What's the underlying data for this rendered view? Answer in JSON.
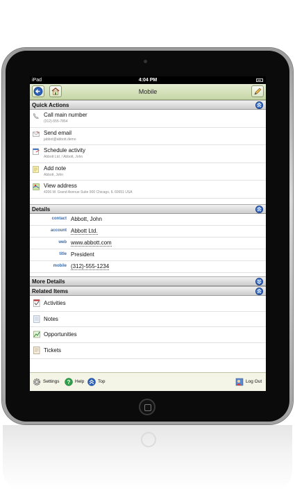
{
  "status_bar": {
    "carrier": "iPad",
    "time": "4:04 PM"
  },
  "toolbar": {
    "title": "Mobile"
  },
  "quick_actions": {
    "title": "Quick Actions",
    "items": [
      {
        "label": "Call main number",
        "sub": "(312)-555-7854",
        "icon": "phone-icon"
      },
      {
        "label": "Send email",
        "sub": "jabbot@abbott.demo",
        "icon": "email-icon"
      },
      {
        "label": "Schedule activity",
        "sub": "Abbott Ltd. / Abbott, John",
        "icon": "calendar-icon"
      },
      {
        "label": "Add note",
        "sub": "Abbott, John",
        "icon": "note-icon"
      },
      {
        "label": "View address",
        "sub": "4206 W. Grand Avenue Suite 900 Chicago, IL 60651 USA",
        "icon": "map-icon"
      }
    ]
  },
  "details": {
    "title": "Details",
    "rows": [
      {
        "label": "contact",
        "value": "Abbott, John"
      },
      {
        "label": "account",
        "value": "Abbott Ltd."
      },
      {
        "label": "web",
        "value": "www.abbott.com"
      },
      {
        "label": "title",
        "value": "President"
      },
      {
        "label": "mobile",
        "value": "(312)-555-1234"
      }
    ]
  },
  "more_details": {
    "title": "More Details"
  },
  "related": {
    "title": "Related Items",
    "items": [
      {
        "label": "Activities",
        "icon": "activities-icon"
      },
      {
        "label": "Notes",
        "icon": "notes-icon"
      },
      {
        "label": "Opportunities",
        "icon": "opportunities-icon"
      },
      {
        "label": "Tickets",
        "icon": "tickets-icon"
      }
    ]
  },
  "footer": {
    "settings": "Settings",
    "help": "Help",
    "top": "Top",
    "logout": "Log Out"
  },
  "colors": {
    "toolbar": "#c7d7a6",
    "link": "#3a6aa8",
    "accent_blue": "#1e4fa8"
  }
}
